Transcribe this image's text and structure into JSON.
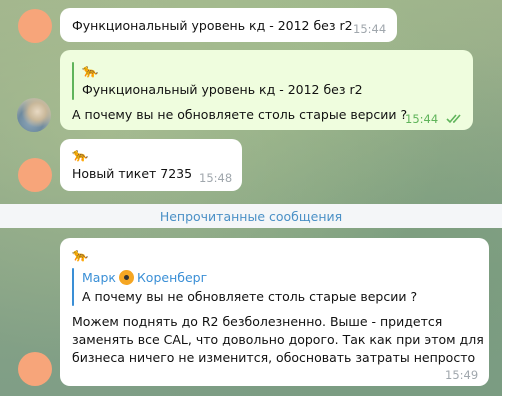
{
  "messages": [
    {
      "text": "Функциональный уровень кд - 2012 без r2",
      "time": "15:44"
    },
    {
      "quote_text": "Функциональный уровень кд - 2012 без r2",
      "text": "А почему вы не обновляете столь старые версии ?",
      "time": "15:44",
      "status": "read"
    },
    {
      "text": "Новый тикет 7235",
      "time": "15:48"
    }
  ],
  "unread_divider": "Непрочитанные сообщения",
  "last_message": {
    "reply_sender_first": "Марк",
    "reply_sender_last": "Коренберг",
    "reply_text": "А почему вы не обновляете столь старые версии ?",
    "lines": [
      "Можем поднять до R2 безболезненно. Выше - придется",
      "заменять все CAL, что довольно дорого. Так как при этом для",
      "бизнеса ничего не изменится, обосновать затраты непросто"
    ],
    "time": "15:49"
  },
  "icons": {
    "dog": "dog-emoji-icon",
    "radioactive": "radioactive-emoji-icon",
    "double_check": "double-check-icon"
  },
  "colors": {
    "incoming_bubble": "#ffffff",
    "outgoing_bubble": "#effdde",
    "accent": "#3a8fd6",
    "read_check": "#5fb45a"
  }
}
